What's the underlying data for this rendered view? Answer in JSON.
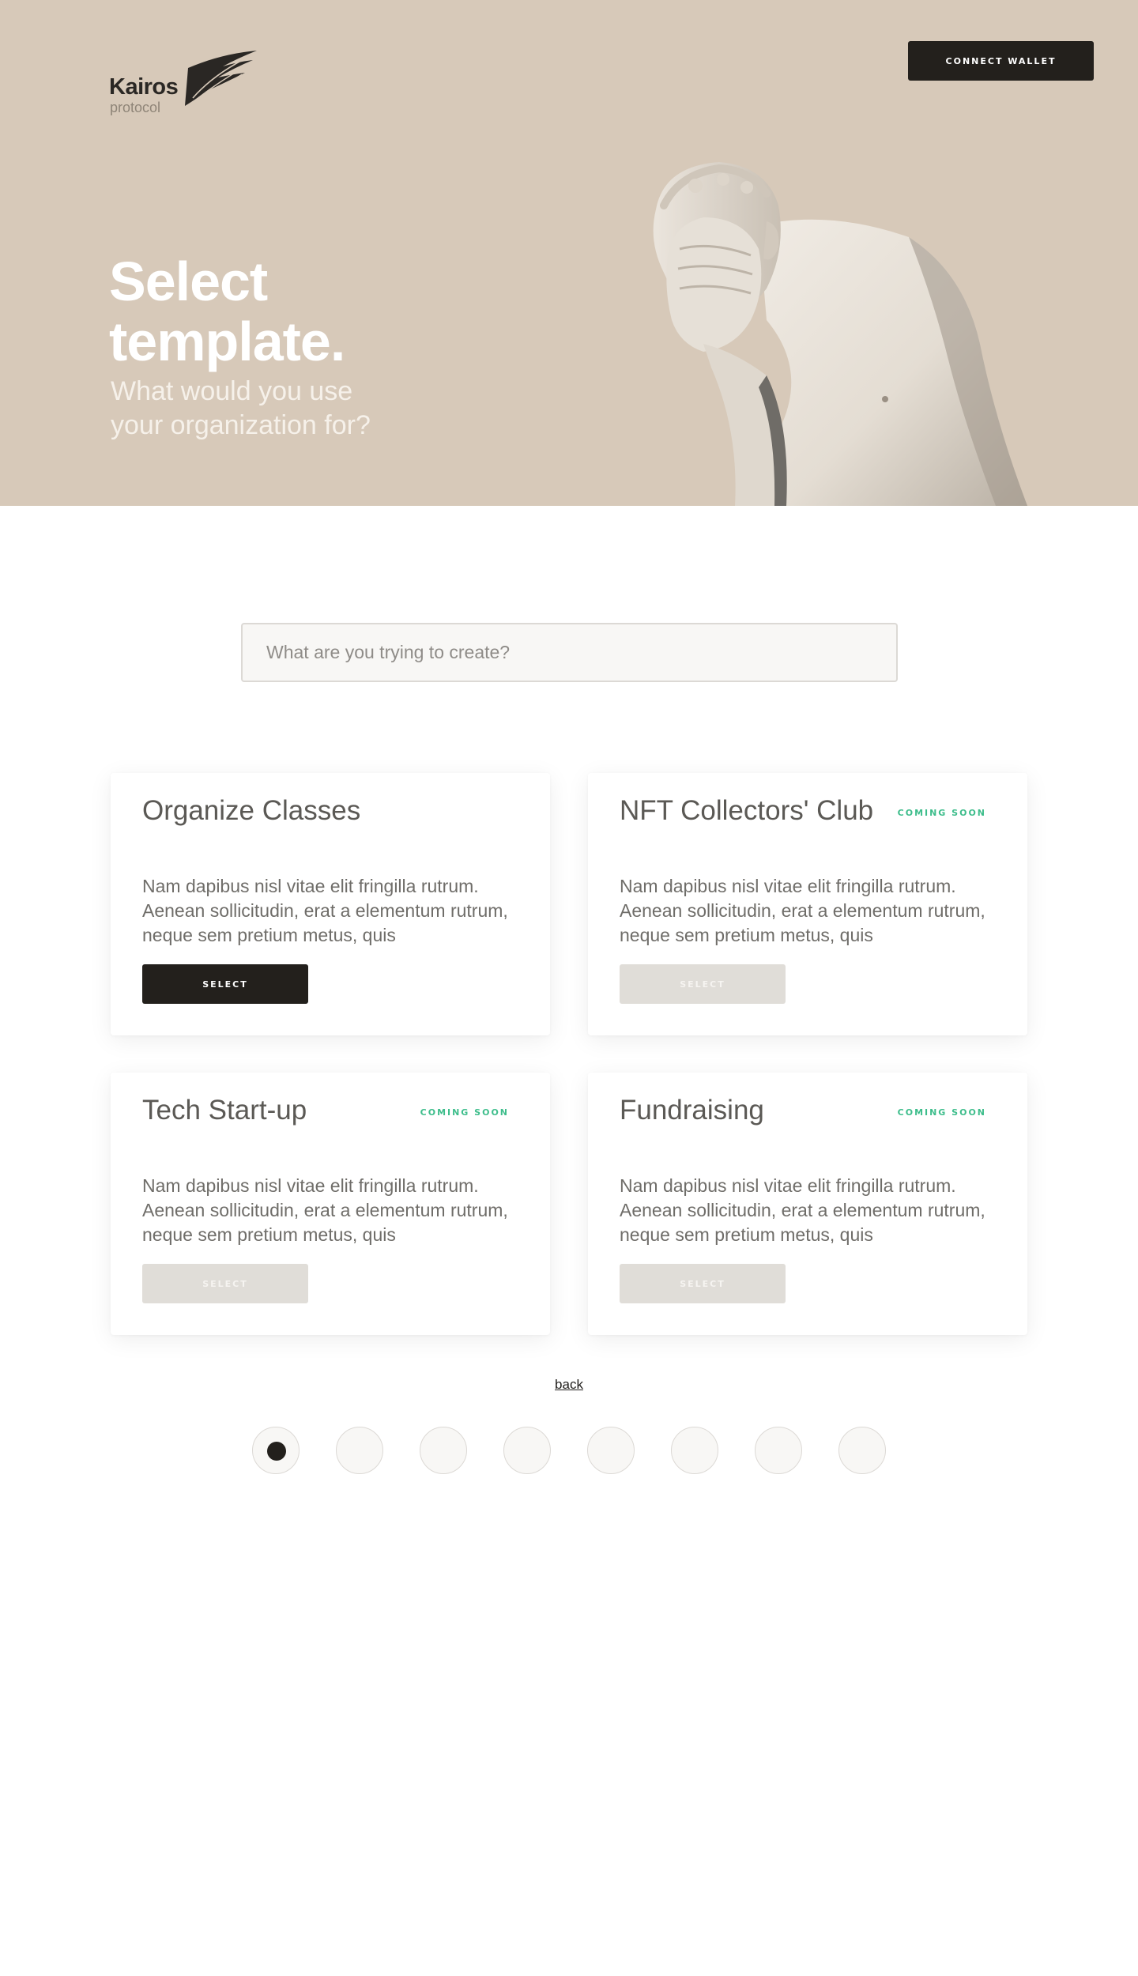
{
  "brand": {
    "name": "Kairos",
    "sub": "protocol"
  },
  "header": {
    "connect_label": "CONNECT WALLET"
  },
  "hero": {
    "title_line1": "Select",
    "title_line2": "template.",
    "subtitle_line1": "What would you use",
    "subtitle_line2": "your organization for?"
  },
  "search": {
    "placeholder": "What are you trying to create?",
    "value": ""
  },
  "templates": [
    {
      "title": "Organize Classes",
      "badge": "",
      "description": "Nam dapibus nisl vitae elit fringilla rutrum. Aenean sollicitudin, erat a elementum rutrum, neque sem pretium metus, quis",
      "button": "SELECT",
      "enabled": true
    },
    {
      "title": "NFT Collectors' Club",
      "badge": "COMING SOON",
      "description": "Nam dapibus nisl vitae elit fringilla rutrum. Aenean sollicitudin, erat a elementum rutrum, neque sem pretium metus, quis",
      "button": "SELECT",
      "enabled": false
    },
    {
      "title": "Tech Start-up",
      "badge": "COMING SOON",
      "description": "Nam dapibus nisl vitae elit fringilla rutrum. Aenean sollicitudin, erat a elementum rutrum, neque sem pretium metus, quis",
      "button": "SELECT",
      "enabled": false
    },
    {
      "title": "Fundraising",
      "badge": "COMING SOON",
      "description": "Nam dapibus nisl vitae elit fringilla rutrum. Aenean sollicitudin, erat a elementum rutrum, neque sem pretium metus, quis",
      "button": "SELECT",
      "enabled": false
    }
  ],
  "nav": {
    "back_label": "back"
  },
  "stepper": {
    "total_steps": 8,
    "current_step": 1
  },
  "colors": {
    "hero_bg": "#d7c9b9",
    "primary": "#23201c",
    "badge": "#3dbd8b",
    "disabled_button": "#e0ddd8"
  }
}
